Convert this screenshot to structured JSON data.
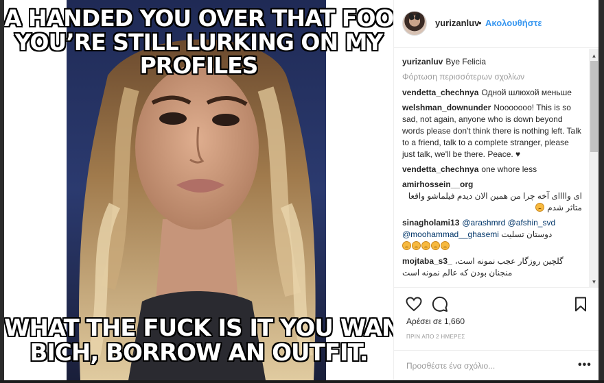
{
  "image": {
    "top_text": [
      "A HANDED YOU OVER THAT FOOL AND",
      "YOU’RE STILL LURKING ON MY",
      "PROFILES"
    ],
    "bottom_text": [
      "WHAT THE FUCK IS IT YOU WANT",
      "BICH, BORROW AN OUTFIT."
    ]
  },
  "header": {
    "username": "yurizanluv",
    "separator": "•",
    "follow_label": "Ακολουθήστε"
  },
  "caption": {
    "username": "yurizanluv",
    "text": "Bye Felicia"
  },
  "load_more": "Φόρτωση περισσότερων σχολίων",
  "comments": [
    {
      "username": "vendetta_chechnya",
      "text": "Одной шлюхой меньше"
    },
    {
      "username": "welshman_downunder",
      "text": "Nooooooo! This is so sad, not again, anyone who is down beyond words please don't think there is nothing left. Talk to a friend, talk to a complete stranger, please just talk, we'll be there. Peace. ♥"
    },
    {
      "username": "vendetta_chechnya",
      "text": "one whore less"
    },
    {
      "username": "amirhossein__org",
      "text": "ای واااای آخه چرا من همین الان دیدم فیلماشو واقعا متاثر شدم"
    },
    {
      "username": "sinagholami13",
      "mention1": "@arashmrd",
      "mention2": "@afshin_svd",
      "mention3": "@moohammad__ghasemi",
      "text": "دوستان تسلیت"
    },
    {
      "username": "mojtaba_s3_",
      "text": "گلچین روزگار عجب نمونه است، منجنان بودن که عالم نمونه است"
    }
  ],
  "likes": "Αρέσει σε 1,660",
  "timestamp": "ΠΡΙΝ ΑΠΟ 2 ΗΜΕΡΕΣ",
  "comment_box": {
    "placeholder": "Προσθέστε ένα σχόλιο...",
    "more": "•••"
  },
  "icons": {
    "like": "heart-icon",
    "comment": "comment-bubble-icon",
    "save": "bookmark-icon",
    "scroll_up": "scroll-up-arrow-icon",
    "scroll_down": "scroll-down-arrow-icon"
  },
  "colors": {
    "link_blue": "#3897f0",
    "text": "#262626",
    "muted": "#999999",
    "border": "#efefef"
  }
}
